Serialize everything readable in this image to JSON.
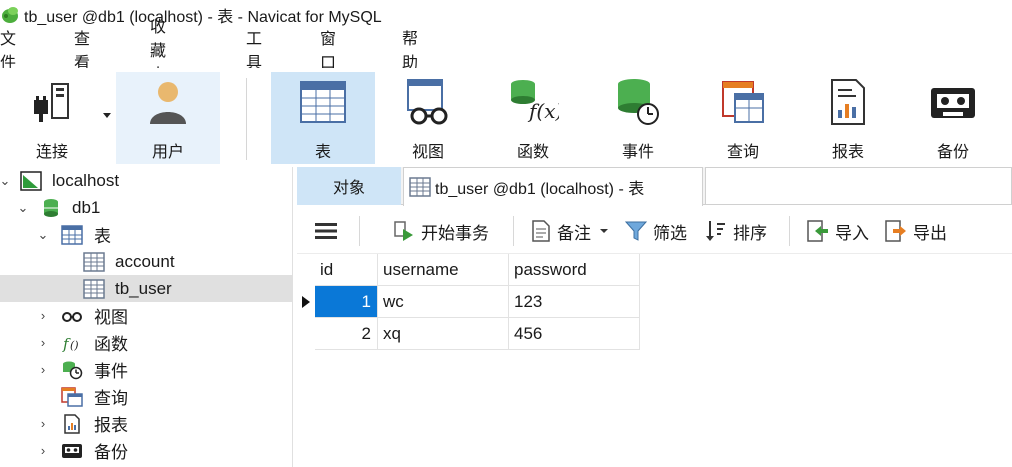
{
  "window": {
    "title": "tb_user @db1 (localhost) - 表 - Navicat for MySQL"
  },
  "menu": {
    "items": [
      "文件",
      "查看",
      "收藏夹",
      "工具",
      "窗口",
      "帮助"
    ]
  },
  "toolbar": {
    "buttons": [
      {
        "label": "连接",
        "icon": "plug-connection-icon"
      },
      {
        "label": "用户",
        "icon": "user-icon"
      },
      {
        "label": "表",
        "icon": "table-icon"
      },
      {
        "label": "视图",
        "icon": "view-glasses-icon"
      },
      {
        "label": "函数",
        "icon": "function-icon"
      },
      {
        "label": "事件",
        "icon": "event-clock-icon"
      },
      {
        "label": "查询",
        "icon": "query-icon"
      },
      {
        "label": "报表",
        "icon": "report-icon"
      },
      {
        "label": "备份",
        "icon": "backup-tape-icon"
      }
    ],
    "active": "表"
  },
  "tree": {
    "connection": "localhost",
    "database": "db1",
    "tables_node": "表",
    "tables": [
      "account",
      "tb_user"
    ],
    "selected_table": "tb_user",
    "other_nodes": [
      "视图",
      "函数",
      "事件",
      "查询",
      "报表",
      "备份"
    ]
  },
  "tabs": {
    "objects": "对象",
    "table_tab": "tb_user @db1 (localhost) - 表"
  },
  "object_toolbar": {
    "begin_transaction": "开始事务",
    "note": "备注",
    "filter": "筛选",
    "sort": "排序",
    "import": "导入",
    "export": "导出"
  },
  "grid": {
    "columns": [
      "id",
      "username",
      "password"
    ],
    "rows": [
      {
        "id": "1",
        "username": "wc",
        "password": "123"
      },
      {
        "id": "2",
        "username": "xq",
        "password": "456"
      }
    ]
  },
  "colors": {
    "accent": "#0a78d7",
    "active_tab": "#cfe5f7",
    "selection_row": "#e0e0e0"
  }
}
